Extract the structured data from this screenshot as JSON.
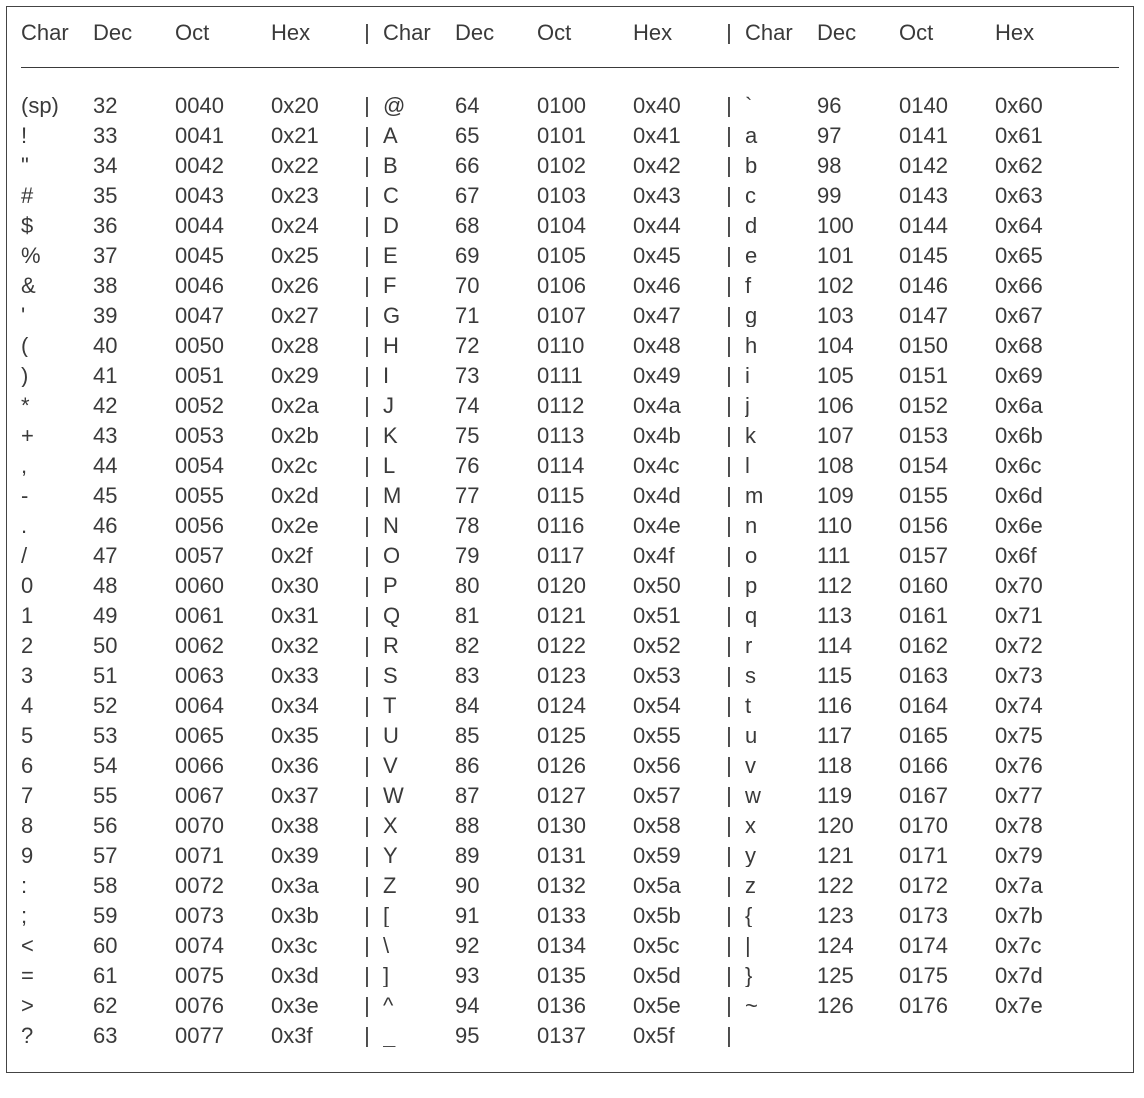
{
  "headers": {
    "char": "Char",
    "dec": "Dec",
    "oct": "Oct",
    "hex": "Hex"
  },
  "sep": "|",
  "chart_data": {
    "type": "table",
    "columns": [
      "Char",
      "Dec",
      "Oct",
      "Hex"
    ],
    "group_count": 3,
    "separator": "|",
    "rows": [
      [
        {
          "char": "(sp)",
          "dec": "32",
          "oct": "0040",
          "hex": "0x20"
        },
        {
          "char": "@",
          "dec": "64",
          "oct": "0100",
          "hex": "0x40"
        },
        {
          "char": "`",
          "dec": "96",
          "oct": "0140",
          "hex": "0x60"
        }
      ],
      [
        {
          "char": "!",
          "dec": "33",
          "oct": "0041",
          "hex": "0x21"
        },
        {
          "char": "A",
          "dec": "65",
          "oct": "0101",
          "hex": "0x41"
        },
        {
          "char": "a",
          "dec": "97",
          "oct": "0141",
          "hex": "0x61"
        }
      ],
      [
        {
          "char": "\"",
          "dec": "34",
          "oct": "0042",
          "hex": "0x22"
        },
        {
          "char": "B",
          "dec": "66",
          "oct": "0102",
          "hex": "0x42"
        },
        {
          "char": "b",
          "dec": "98",
          "oct": "0142",
          "hex": "0x62"
        }
      ],
      [
        {
          "char": "#",
          "dec": "35",
          "oct": "0043",
          "hex": "0x23"
        },
        {
          "char": "C",
          "dec": "67",
          "oct": "0103",
          "hex": "0x43"
        },
        {
          "char": "c",
          "dec": "99",
          "oct": "0143",
          "hex": "0x63"
        }
      ],
      [
        {
          "char": "$",
          "dec": "36",
          "oct": "0044",
          "hex": "0x24"
        },
        {
          "char": "D",
          "dec": "68",
          "oct": "0104",
          "hex": "0x44"
        },
        {
          "char": "d",
          "dec": "100",
          "oct": "0144",
          "hex": "0x64"
        }
      ],
      [
        {
          "char": "%",
          "dec": "37",
          "oct": "0045",
          "hex": "0x25"
        },
        {
          "char": "E",
          "dec": "69",
          "oct": "0105",
          "hex": "0x45"
        },
        {
          "char": "e",
          "dec": "101",
          "oct": "0145",
          "hex": "0x65"
        }
      ],
      [
        {
          "char": "&",
          "dec": "38",
          "oct": "0046",
          "hex": "0x26"
        },
        {
          "char": "F",
          "dec": "70",
          "oct": "0106",
          "hex": "0x46"
        },
        {
          "char": "f",
          "dec": "102",
          "oct": "0146",
          "hex": "0x66"
        }
      ],
      [
        {
          "char": "'",
          "dec": "39",
          "oct": "0047",
          "hex": "0x27"
        },
        {
          "char": "G",
          "dec": "71",
          "oct": "0107",
          "hex": "0x47"
        },
        {
          "char": "g",
          "dec": "103",
          "oct": "0147",
          "hex": "0x67"
        }
      ],
      [
        {
          "char": "(",
          "dec": "40",
          "oct": "0050",
          "hex": "0x28"
        },
        {
          "char": "H",
          "dec": "72",
          "oct": "0110",
          "hex": "0x48"
        },
        {
          "char": "h",
          "dec": "104",
          "oct": "0150",
          "hex": "0x68"
        }
      ],
      [
        {
          "char": ")",
          "dec": "41",
          "oct": "0051",
          "hex": "0x29"
        },
        {
          "char": "I",
          "dec": "73",
          "oct": "0111",
          "hex": "0x49"
        },
        {
          "char": "i",
          "dec": "105",
          "oct": "0151",
          "hex": "0x69"
        }
      ],
      [
        {
          "char": "*",
          "dec": "42",
          "oct": "0052",
          "hex": "0x2a"
        },
        {
          "char": "J",
          "dec": "74",
          "oct": "0112",
          "hex": "0x4a"
        },
        {
          "char": "j",
          "dec": "106",
          "oct": "0152",
          "hex": "0x6a"
        }
      ],
      [
        {
          "char": "+",
          "dec": "43",
          "oct": "0053",
          "hex": "0x2b"
        },
        {
          "char": "K",
          "dec": "75",
          "oct": "0113",
          "hex": "0x4b"
        },
        {
          "char": "k",
          "dec": "107",
          "oct": "0153",
          "hex": "0x6b"
        }
      ],
      [
        {
          "char": ",",
          "dec": "44",
          "oct": "0054",
          "hex": "0x2c"
        },
        {
          "char": "L",
          "dec": "76",
          "oct": "0114",
          "hex": "0x4c"
        },
        {
          "char": "l",
          "dec": "108",
          "oct": "0154",
          "hex": "0x6c"
        }
      ],
      [
        {
          "char": "-",
          "dec": "45",
          "oct": "0055",
          "hex": "0x2d"
        },
        {
          "char": "M",
          "dec": "77",
          "oct": "0115",
          "hex": "0x4d"
        },
        {
          "char": "m",
          "dec": "109",
          "oct": "0155",
          "hex": "0x6d"
        }
      ],
      [
        {
          "char": ".",
          "dec": "46",
          "oct": "0056",
          "hex": "0x2e"
        },
        {
          "char": "N",
          "dec": "78",
          "oct": "0116",
          "hex": "0x4e"
        },
        {
          "char": "n",
          "dec": "110",
          "oct": "0156",
          "hex": "0x6e"
        }
      ],
      [
        {
          "char": "/",
          "dec": "47",
          "oct": "0057",
          "hex": "0x2f"
        },
        {
          "char": "O",
          "dec": "79",
          "oct": "0117",
          "hex": "0x4f"
        },
        {
          "char": "o",
          "dec": "111",
          "oct": "0157",
          "hex": "0x6f"
        }
      ],
      [
        {
          "char": "0",
          "dec": "48",
          "oct": "0060",
          "hex": "0x30"
        },
        {
          "char": "P",
          "dec": "80",
          "oct": "0120",
          "hex": "0x50"
        },
        {
          "char": "p",
          "dec": "112",
          "oct": "0160",
          "hex": "0x70"
        }
      ],
      [
        {
          "char": "1",
          "dec": "49",
          "oct": "0061",
          "hex": "0x31"
        },
        {
          "char": "Q",
          "dec": "81",
          "oct": "0121",
          "hex": "0x51"
        },
        {
          "char": "q",
          "dec": "113",
          "oct": "0161",
          "hex": "0x71"
        }
      ],
      [
        {
          "char": "2",
          "dec": "50",
          "oct": "0062",
          "hex": "0x32"
        },
        {
          "char": "R",
          "dec": "82",
          "oct": "0122",
          "hex": "0x52"
        },
        {
          "char": "r",
          "dec": "114",
          "oct": "0162",
          "hex": "0x72"
        }
      ],
      [
        {
          "char": "3",
          "dec": "51",
          "oct": "0063",
          "hex": "0x33"
        },
        {
          "char": "S",
          "dec": "83",
          "oct": "0123",
          "hex": "0x53"
        },
        {
          "char": "s",
          "dec": "115",
          "oct": "0163",
          "hex": "0x73"
        }
      ],
      [
        {
          "char": "4",
          "dec": "52",
          "oct": "0064",
          "hex": "0x34"
        },
        {
          "char": "T",
          "dec": "84",
          "oct": "0124",
          "hex": "0x54"
        },
        {
          "char": "t",
          "dec": "116",
          "oct": "0164",
          "hex": "0x74"
        }
      ],
      [
        {
          "char": "5",
          "dec": "53",
          "oct": "0065",
          "hex": "0x35"
        },
        {
          "char": "U",
          "dec": "85",
          "oct": "0125",
          "hex": "0x55"
        },
        {
          "char": "u",
          "dec": "117",
          "oct": "0165",
          "hex": "0x75"
        }
      ],
      [
        {
          "char": "6",
          "dec": "54",
          "oct": "0066",
          "hex": "0x36"
        },
        {
          "char": "V",
          "dec": "86",
          "oct": "0126",
          "hex": "0x56"
        },
        {
          "char": "v",
          "dec": "118",
          "oct": "0166",
          "hex": "0x76"
        }
      ],
      [
        {
          "char": "7",
          "dec": "55",
          "oct": "0067",
          "hex": "0x37"
        },
        {
          "char": "W",
          "dec": "87",
          "oct": "0127",
          "hex": "0x57"
        },
        {
          "char": "w",
          "dec": "119",
          "oct": "0167",
          "hex": "0x77"
        }
      ],
      [
        {
          "char": "8",
          "dec": "56",
          "oct": "0070",
          "hex": "0x38"
        },
        {
          "char": "X",
          "dec": "88",
          "oct": "0130",
          "hex": "0x58"
        },
        {
          "char": "x",
          "dec": "120",
          "oct": "0170",
          "hex": "0x78"
        }
      ],
      [
        {
          "char": "9",
          "dec": "57",
          "oct": "0071",
          "hex": "0x39"
        },
        {
          "char": "Y",
          "dec": "89",
          "oct": "0131",
          "hex": "0x59"
        },
        {
          "char": "y",
          "dec": "121",
          "oct": "0171",
          "hex": "0x79"
        }
      ],
      [
        {
          "char": ":",
          "dec": "58",
          "oct": "0072",
          "hex": "0x3a"
        },
        {
          "char": "Z",
          "dec": "90",
          "oct": "0132",
          "hex": "0x5a"
        },
        {
          "char": "z",
          "dec": "122",
          "oct": "0172",
          "hex": "0x7a"
        }
      ],
      [
        {
          "char": ";",
          "dec": "59",
          "oct": "0073",
          "hex": "0x3b"
        },
        {
          "char": "[",
          "dec": "91",
          "oct": "0133",
          "hex": "0x5b"
        },
        {
          "char": "{",
          "dec": "123",
          "oct": "0173",
          "hex": "0x7b"
        }
      ],
      [
        {
          "char": "<",
          "dec": "60",
          "oct": "0074",
          "hex": "0x3c"
        },
        {
          "char": "\\",
          "dec": "92",
          "oct": "0134",
          "hex": "0x5c"
        },
        {
          "char": "|",
          "dec": "124",
          "oct": "0174",
          "hex": "0x7c"
        }
      ],
      [
        {
          "char": "=",
          "dec": "61",
          "oct": "0075",
          "hex": "0x3d"
        },
        {
          "char": "]",
          "dec": "93",
          "oct": "0135",
          "hex": "0x5d"
        },
        {
          "char": "}",
          "dec": "125",
          "oct": "0175",
          "hex": "0x7d"
        }
      ],
      [
        {
          "char": ">",
          "dec": "62",
          "oct": "0076",
          "hex": "0x3e"
        },
        {
          "char": "^",
          "dec": "94",
          "oct": "0136",
          "hex": "0x5e"
        },
        {
          "char": "~",
          "dec": "126",
          "oct": "0176",
          "hex": "0x7e"
        }
      ],
      [
        {
          "char": "?",
          "dec": "63",
          "oct": "0077",
          "hex": "0x3f"
        },
        {
          "char": "_",
          "dec": "95",
          "oct": "0137",
          "hex": "0x5f"
        },
        null
      ]
    ]
  }
}
